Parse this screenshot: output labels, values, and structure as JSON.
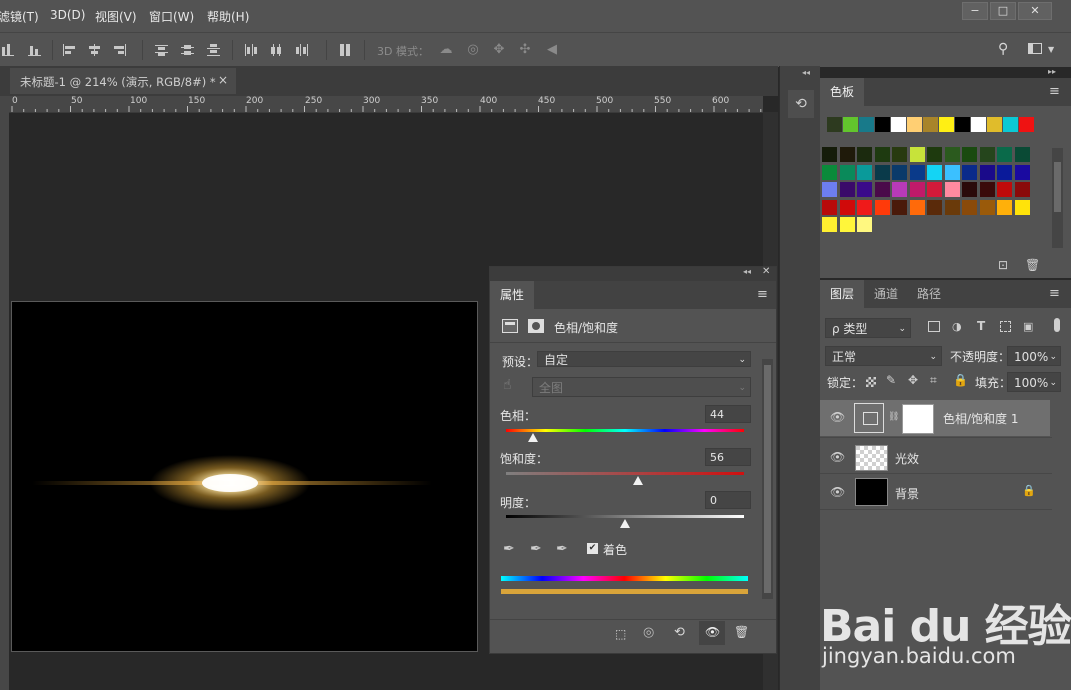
{
  "menu": [
    "滤镜(T)",
    "3D(D)",
    "视图(V)",
    "窗口(W)",
    "帮助(H)"
  ],
  "window_controls": {
    "minimize": "−",
    "restore": "□",
    "close": "✕"
  },
  "options_bar": {
    "mode_label": "3D 模式："
  },
  "document_tab": {
    "title": "未标题-1 @ 214% (演示, RGB/8#) *",
    "close": "×"
  },
  "ruler_labels": [
    "0",
    "50",
    "100",
    "150",
    "200",
    "250",
    "300",
    "350",
    "400",
    "450",
    "500",
    "550",
    "600"
  ],
  "swatches_panel": {
    "tab": "色板",
    "recent": [
      "#2d3a1f",
      "#62c52d",
      "#187a8a",
      "#000000",
      "#ffffff",
      "#ffcf73",
      "#a8842a",
      "#ffef14",
      "#000000",
      "#ffffff",
      "#e0bc2b",
      "#0bc9d4",
      "#ef1212"
    ],
    "grid": [
      "#151c0a",
      "#1f1a0a",
      "#1b2a0e",
      "#1e3a10",
      "#283a10",
      "#c7e33a",
      "#1e3a0e",
      "#2b5a1e",
      "#1a4a10",
      "#25451c",
      "#0a6a4a",
      "#0a4a35",
      "#0a8a3a",
      "#0a8a5a",
      "#0a9a9a",
      "#0a3a4a",
      "#0a3a6a",
      "#0a3a8a",
      "#14d4f4",
      "#3bc0ff",
      "#0a2a8a",
      "#1a0a8a",
      "#0a1a9a",
      "#1a0aa0",
      "#6d7ef0",
      "#3a0a6a",
      "#3a0a8a",
      "#4a0a4a",
      "#b83ab8",
      "#c01a6a",
      "#d21a3a",
      "#ff8aa0",
      "#2a0a0a",
      "#3a0a0a",
      "#c00a0a",
      "#8a0a0a",
      "#b80a0a",
      "#d00a0a",
      "#ef1a1a",
      "#ff3a0a",
      "#4a1a0a",
      "#ff6a0a",
      "#5a2a0a",
      "#6a3a0a",
      "#8a4a0a",
      "#9a5a0a",
      "#ffb00a",
      "#ffe30a",
      "#fff030",
      "#fff63a",
      "#fff880"
    ]
  },
  "layers_panel": {
    "tabs": [
      "图层",
      "通道",
      "路径"
    ],
    "filter": "ρ 类型",
    "blend_mode": "正常",
    "opacity_label": "不透明度：",
    "opacity": "100%",
    "lock_label": "锁定：",
    "fill_label": "填充：",
    "fill": "100%",
    "layers": [
      {
        "name": "色相/饱和度 1",
        "type": "adjustment"
      },
      {
        "name": "光效",
        "type": "transparent"
      },
      {
        "name": "背景",
        "type": "black"
      }
    ]
  },
  "properties_panel": {
    "tab": "属性",
    "title": "色相/饱和度",
    "preset_label": "预设：",
    "preset": "自定",
    "channel": "全图",
    "hue_label": "色相：",
    "hue": "44",
    "saturation_label": "饱和度：",
    "saturation": "56",
    "lightness_label": "明度：",
    "lightness": "0",
    "colorize_label": "着色",
    "colorize_color": "#d9a43a"
  },
  "watermark": {
    "text": "Bai du 经验",
    "url": "jingyan.baidu.com"
  }
}
